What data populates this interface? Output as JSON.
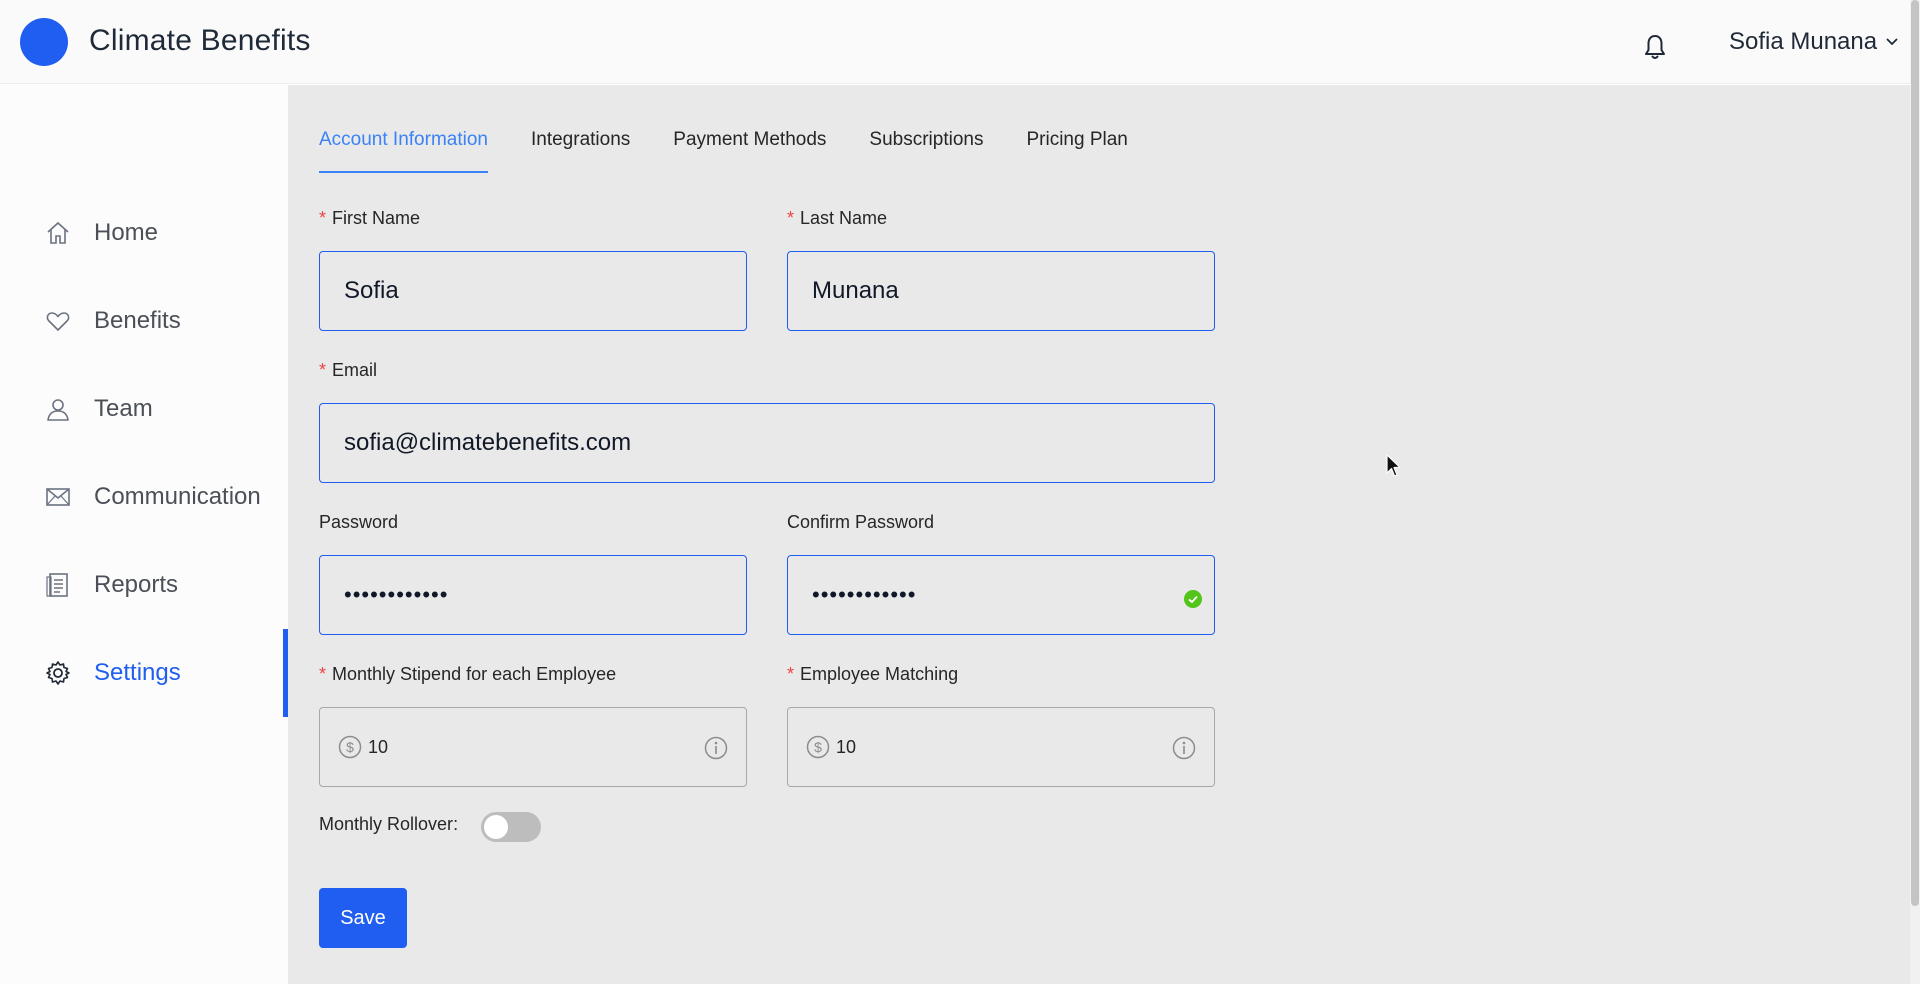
{
  "header": {
    "app_title": "Climate Benefits",
    "user_name": "Sofia Munana",
    "logo_color": "#1f5ef0"
  },
  "sidebar": {
    "items": [
      {
        "label": "Home",
        "icon": "home-icon",
        "active": false
      },
      {
        "label": "Benefits",
        "icon": "heart-icon",
        "active": false
      },
      {
        "label": "Team",
        "icon": "user-icon",
        "active": false
      },
      {
        "label": "Communication",
        "icon": "mail-icon",
        "active": false
      },
      {
        "label": "Reports",
        "icon": "document-icon",
        "active": false
      },
      {
        "label": "Settings",
        "icon": "gear-icon",
        "active": true
      }
    ]
  },
  "tabs": [
    {
      "label": "Account Information",
      "active": true
    },
    {
      "label": "Integrations",
      "active": false
    },
    {
      "label": "Payment Methods",
      "active": false
    },
    {
      "label": "Subscriptions",
      "active": false
    },
    {
      "label": "Pricing Plan",
      "active": false
    }
  ],
  "form": {
    "first_name": {
      "label": "First Name",
      "required": "*",
      "value": "Sofia"
    },
    "last_name": {
      "label": "Last Name",
      "required": "*",
      "value": "Munana"
    },
    "email": {
      "label": "Email",
      "required": "*",
      "value": "sofia@climatebenefits.com"
    },
    "password": {
      "label": "Password",
      "value": "••••••••••••"
    },
    "confirm_password": {
      "label": "Confirm Password",
      "value": "••••••••••••"
    },
    "stipend": {
      "label": "Monthly Stipend for each Employee",
      "required": "*",
      "value": "10"
    },
    "matching": {
      "label": "Employee Matching",
      "required": "*",
      "value": "10"
    },
    "rollover": {
      "label": "Monthly Rollover",
      "colon": ":",
      "enabled": false
    },
    "save_label": "Save"
  },
  "colors": {
    "accent": "#1f5ef0",
    "tab_active": "#3b82f6",
    "required": "#ef4444",
    "success": "#52c41a"
  }
}
